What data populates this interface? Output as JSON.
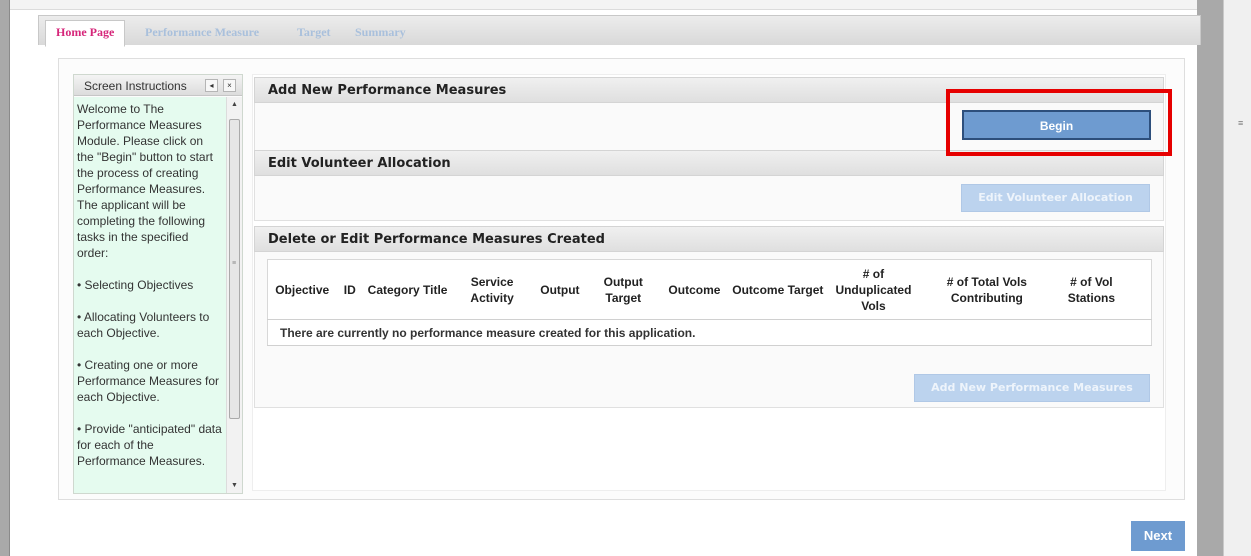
{
  "tabs": [
    {
      "label": "Home Page",
      "active": true
    },
    {
      "label": "Performance Measure",
      "active": false
    },
    {
      "label": "Target",
      "active": false
    },
    {
      "label": "Summary",
      "active": false
    }
  ],
  "instructions": {
    "title": "Screen Instructions",
    "collapse_icon": "◂",
    "close_icon": "×",
    "paragraphs": [
      "Welcome to The Performance Measures Module. Please click on the \"Begin\" button to start the process of creating Performance Measures. The applicant will be completing the following tasks in the specified order:",
      "• Selecting Objectives",
      "• Allocating Volunteers to each Objective.",
      "• Creating one or more Performance Measures for each Objective.",
      "• Provide \"anticipated\" data for each of the Performance Measures."
    ]
  },
  "sections": {
    "add_new": {
      "title": "Add New Performance Measures",
      "button": "Begin"
    },
    "edit_vol": {
      "title": "Edit Volunteer Allocation",
      "button": "Edit Volunteer Allocation"
    },
    "delete_edit": {
      "title": "Delete or Edit Performance Measures Created",
      "columns": [
        "Objective",
        "ID",
        "Category Title",
        "Service Activity",
        "Output",
        "Output Target",
        "Outcome",
        "Outcome Target",
        "# of Unduplicated Vols",
        "# of Total Vols Contributing",
        "# of Vol Stations",
        ""
      ],
      "empty_message": "There are currently no performance measure created for this application.",
      "button": "Add New Performance Measures"
    }
  },
  "footer": {
    "next_label": "Next"
  },
  "colors": {
    "accent_blue": "#6e9bd0",
    "active_tab": "#d6267a",
    "highlight": "#e60000"
  }
}
